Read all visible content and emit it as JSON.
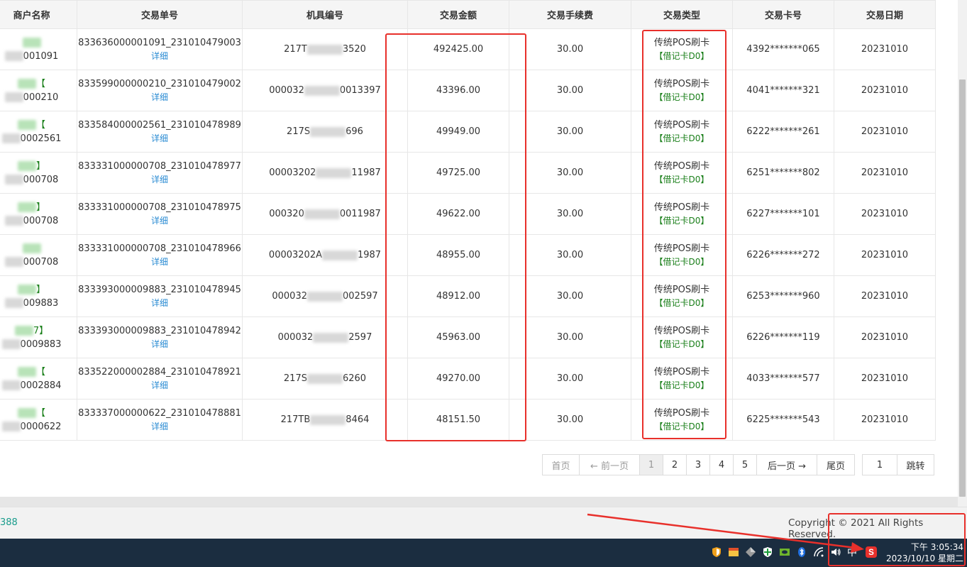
{
  "table": {
    "headers": [
      "商户名称",
      "交易单号",
      "机具编号",
      "交易金额",
      "交易手续费",
      "交易类型",
      "交易卡号",
      "交易日期"
    ],
    "detail_label": "详细",
    "rows": [
      {
        "merchant_tag": "",
        "merchant_no": "001091",
        "order_no": "833636000001091_231010479003",
        "terminal_a": "217T",
        "terminal_b": "3520",
        "amount": "492425.00",
        "fee": "30.00",
        "type": "传统POS刷卡",
        "type_sub": "【借记卡D0】",
        "card": "4392*******065",
        "date": "20231010"
      },
      {
        "merchant_tag": "【",
        "merchant_no": "000210",
        "order_no": "833599000000210_231010479002",
        "terminal_a": "000032",
        "terminal_b": "0013397",
        "amount": "43396.00",
        "fee": "30.00",
        "type": "传统POS刷卡",
        "type_sub": "【借记卡D0】",
        "card": "4041*******321",
        "date": "20231010"
      },
      {
        "merchant_tag": "【",
        "merchant_no": "0002561",
        "order_no": "833584000002561_231010478989",
        "terminal_a": "217S",
        "terminal_b": "696",
        "amount": "49949.00",
        "fee": "30.00",
        "type": "传统POS刷卡",
        "type_sub": "【借记卡D0】",
        "card": "6222*******261",
        "date": "20231010"
      },
      {
        "merchant_tag": "】",
        "merchant_no": "000708",
        "order_no": "833331000000708_231010478977",
        "terminal_a": "00003202",
        "terminal_b": "11987",
        "amount": "49725.00",
        "fee": "30.00",
        "type": "传统POS刷卡",
        "type_sub": "【借记卡D0】",
        "card": "6251*******802",
        "date": "20231010"
      },
      {
        "merchant_tag": "】",
        "merchant_no": "000708",
        "order_no": "833331000000708_231010478975",
        "terminal_a": "000320",
        "terminal_b": "0011987",
        "amount": "49622.00",
        "fee": "30.00",
        "type": "传统POS刷卡",
        "type_sub": "【借记卡D0】",
        "card": "6227*******101",
        "date": "20231010"
      },
      {
        "merchant_tag": "",
        "merchant_no": "000708",
        "order_no": "833331000000708_231010478966",
        "terminal_a": "00003202A",
        "terminal_b": "1987",
        "amount": "48955.00",
        "fee": "30.00",
        "type": "传统POS刷卡",
        "type_sub": "【借记卡D0】",
        "card": "6226*******272",
        "date": "20231010"
      },
      {
        "merchant_tag": "】",
        "merchant_no": "009883",
        "order_no": "833393000009883_231010478945",
        "terminal_a": "000032",
        "terminal_b": "002597",
        "amount": "48912.00",
        "fee": "30.00",
        "type": "传统POS刷卡",
        "type_sub": "【借记卡D0】",
        "card": "6253*******960",
        "date": "20231010"
      },
      {
        "merchant_tag": "7】",
        "merchant_no": "0009883",
        "order_no": "833393000009883_231010478942",
        "terminal_a": "000032",
        "terminal_b": "2597",
        "amount": "45963.00",
        "fee": "30.00",
        "type": "传统POS刷卡",
        "type_sub": "【借记卡D0】",
        "card": "6226*******119",
        "date": "20231010"
      },
      {
        "merchant_tag": "【",
        "merchant_no": "0002884",
        "order_no": "833522000002884_231010478921",
        "terminal_a": "217S",
        "terminal_b": "6260",
        "amount": "49270.00",
        "fee": "30.00",
        "type": "传统POS刷卡",
        "type_sub": "【借记卡D0】",
        "card": "4033*******577",
        "date": "20231010"
      },
      {
        "merchant_tag": "【",
        "merchant_no": "0000622",
        "order_no": "833337000000622_231010478881",
        "terminal_a": "217TB",
        "terminal_b": "8464",
        "amount": "48151.50",
        "fee": "30.00",
        "type": "传统POS刷卡",
        "type_sub": "【借记卡D0】",
        "card": "6225*******543",
        "date": "20231010"
      }
    ]
  },
  "pagination": {
    "first": "首页",
    "prev": "← 前一页",
    "pages": [
      "1",
      "2",
      "3",
      "4",
      "5"
    ],
    "current": "1",
    "next": "后一页 →",
    "last": "尾页",
    "jump_value": "1",
    "jump_label": "跳转"
  },
  "footer": {
    "left_text": "388",
    "copyright": "Copyright © 2021 All Rights Reserved."
  },
  "taskbar": {
    "ime": "中",
    "time": "下午 3:05:34",
    "date": "2023/10/10 星期二"
  },
  "colors": {
    "annotation_red": "#e8302b",
    "taskbar_bg": "#1b2d40",
    "link_blue": "#2a8bd3",
    "tag_green": "#1a7f1a"
  }
}
